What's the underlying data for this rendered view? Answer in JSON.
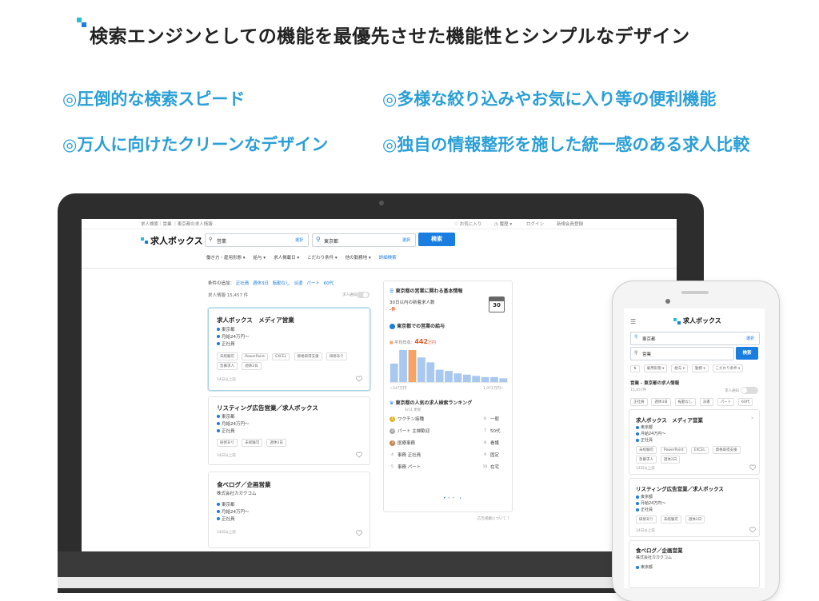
{
  "headline": {
    "title": "検索エンジンとしての機能を最優先させた機能性とシンプルなデザイン",
    "features": [
      "◎圧倒的な検索スピード",
      "◎多様な絞り込みやお気に入り等の便利機能",
      "◎万人に向けたクリーンなデザイン",
      "◎独自の情報整形を施した統一感のある求人比較"
    ]
  },
  "colors": {
    "accent": "#2a9fd6",
    "brand_blue": "#1a7de0",
    "brand_teal": "#20c1d6",
    "highlight_orange": "#f5a466",
    "bar_blue": "#a9c8ef"
  },
  "desktop": {
    "util": {
      "breadcrumb": "求人検索｜営業 ｜東京都の求人情報",
      "favorites": "お気に入り",
      "history": "履歴",
      "login": "ログイン",
      "register": "新規会員登録"
    },
    "brand": "求人ボックス",
    "search": {
      "keyword": "営業",
      "keyword_select": "選択",
      "location": "東京都",
      "location_select": "選択",
      "submit": "検索"
    },
    "filters": [
      "働き方・雇用形態",
      "給与",
      "求人掲載日",
      "こだわり条件",
      "他の勤務地"
    ],
    "detail_search": "詳細検索",
    "conditions": {
      "label": "条件の追加：",
      "items": [
        "正社員",
        "週休3日",
        "転勤なし",
        "派遣",
        "パート",
        "60代"
      ]
    },
    "count_text": "求人情報 15,457 件",
    "alert_label": "求人通知",
    "jobs": [
      {
        "title": "求人ボックス　メディア営業",
        "company": "",
        "location": "東京都",
        "salary": "月給24万円〜",
        "type": "正社員",
        "tags": [
          "未経験可",
          "PowerPoint",
          "EXCEL",
          "資格取得支援",
          "研修あり",
          "急募求人",
          "週休2日"
        ],
        "date": "14日以上前"
      },
      {
        "title": "リスティング広告営業／求人ボックス",
        "company": "",
        "location": "東京都",
        "salary": "月給24万円〜",
        "type": "正社員",
        "tags": [
          "研修あり",
          "未経験可",
          "週休2日"
        ],
        "date": "14日以上前"
      },
      {
        "title": "食べログ／企画営業",
        "company": "株式会社カカクコム",
        "location": "東京都",
        "salary": "月給24万円〜",
        "type": "正社員",
        "tags": [],
        "date": "14日以上前"
      }
    ],
    "info": {
      "title": "東京都の営業に関わる基本情報",
      "new_jobs_label": "30日以内の新着求人数",
      "new_jobs_value": "-件",
      "calendar_day": "30",
      "salary_title": "東京都での営業の給与",
      "avg_label": "平均年収：",
      "avg_value": "442",
      "avg_unit": "万円",
      "hist_values": [
        30,
        52,
        52,
        40,
        32,
        20,
        18,
        14,
        12,
        10,
        8,
        8,
        6
      ],
      "hist_highlight": 2,
      "axis_min": "~347万円",
      "axis_max": "1,071万円~"
    },
    "ranking": {
      "title": "東京都の人気の求人検索ランキング",
      "date": "4/11 更新",
      "left": [
        "ワクチン接種",
        "パート 主婦歓迎",
        "医療事務",
        "事務 正社員",
        "事務 パート"
      ],
      "right_numbers": [
        "6",
        "7",
        "8",
        "9",
        "10"
      ],
      "right_labels": [
        "一般",
        "50代",
        "看護",
        "固定",
        "在宅"
      ]
    },
    "footer_link": "広告掲載について"
  },
  "mobile": {
    "brand": "求人ボックス",
    "location": "東京都",
    "location_select": "選択",
    "keyword": "営業",
    "search_btn": "検索",
    "filters": [
      "雇用形態",
      "給与",
      "勤務",
      "こだわり条件"
    ],
    "heading": "営業 - 東京都の求人情報",
    "count": "15,457件",
    "alert_label": "求人通知",
    "chips": [
      "正社員",
      "週休3日",
      "転勤なし",
      "派遣",
      "パート",
      "60代"
    ],
    "jobs": [
      {
        "title": "求人ボックス　メディア営業",
        "company": "",
        "location": "東京都",
        "salary": "月給24万円〜",
        "type": "正社員",
        "tags": [
          "未経験可",
          "PowerPoint",
          "EXCEL",
          "資格取得支援",
          "急募求人",
          "週休2日"
        ],
        "date": "14日以上前"
      },
      {
        "title": "リスティング広告営業／求人ボックス",
        "company": "",
        "location": "東京都",
        "salary": "月給24万円〜",
        "type": "正社員",
        "tags": [
          "研修あり",
          "未経験可",
          "週休2日"
        ],
        "date": "14日以上前"
      },
      {
        "title": "食べログ／企画営業",
        "company": "株式会社カカクコム",
        "location": "東京都",
        "salary": "",
        "type": "",
        "tags": [],
        "date": ""
      }
    ]
  }
}
